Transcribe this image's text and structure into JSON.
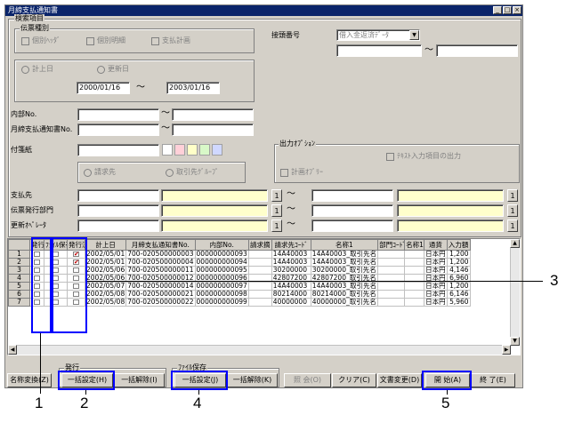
{
  "window": {
    "title": "月締支払通知書",
    "controls": [
      "_",
      "□",
      "×"
    ]
  },
  "search": {
    "group_label": "検索項目",
    "slip_type": {
      "label": "伝票種別",
      "options": [
        "個別ﾍｯﾀﾞ",
        "個別明細",
        "支払計画"
      ]
    },
    "output_order": {
      "label": "接頭番号",
      "select_value": "借入金返済ﾃﾞｰﾀ",
      "tilde": "～"
    },
    "date_type": {
      "options": [
        "計上日",
        "更新日"
      ]
    },
    "date_from": "2000/01/16",
    "date_to": "2003/01/16",
    "date_tilde": "～",
    "internal_no": {
      "label": "内部No.",
      "tilde": "～"
    },
    "notice_no": {
      "label": "月締支払通知書No.",
      "tilde": "～"
    },
    "attachment": {
      "label": "付箋紙"
    },
    "payee_type": {
      "options": [
        "請求先",
        "取引先ｸﾞﾙｰﾌﾟ"
      ]
    },
    "output_options": {
      "label": "出力ｵﾌﾟｼｮﾝ",
      "text_input": "ﾃｷｽﾄ入力項目の出力",
      "plan_only": "計画ｵﾌﾞﾘｰ"
    },
    "payee": {
      "label": "支払先",
      "tilde": "～"
    },
    "dept": {
      "label": "伝票発行部門",
      "tilde": "～"
    },
    "updater": {
      "label": "更新ｵﾍﾟﾚｰﾀ",
      "tilde": "～"
    },
    "lookup_btn": "1"
  },
  "swatch_colors": [
    "#ffffff",
    "#ffd0d8",
    "#ffffc8",
    "#d8f8c8",
    "#d0d8ff"
  ],
  "grid": {
    "headers": [
      "",
      "発行",
      "ﾌｧｲﾙ保存",
      "発行済",
      "計上日",
      "月締支払通知書No.",
      "内部No.",
      "請求摘",
      "請求先ｺｰﾄﾞ",
      "名称1",
      "部門ｺｰﾄﾞ",
      "名称1",
      "通貨",
      "入力額"
    ],
    "rows": [
      {
        "n": "1",
        "issued": "✔",
        "date": "2002/05/01",
        "notice": "700-020500000003",
        "internal": "000000000093",
        "code": "14A40003",
        "name": "14A40003_取引先名",
        "cur": "日本円",
        "amt": "1,200"
      },
      {
        "n": "2",
        "issued": "✔",
        "date": "2002/05/01",
        "notice": "700-020500000004",
        "internal": "000000000094",
        "code": "14A40003",
        "name": "14A40003_取引先名",
        "cur": "日本円",
        "amt": "1,200"
      },
      {
        "n": "3",
        "issued": "",
        "date": "2002/05/06",
        "notice": "700-020500000011",
        "internal": "000000000095",
        "code": "30200000",
        "name": "30200000_取引先名",
        "cur": "日本円",
        "amt": "4,146"
      },
      {
        "n": "4",
        "issued": "",
        "date": "2002/05/06",
        "notice": "700-020500000012",
        "internal": "000000000096",
        "code": "42807200",
        "name": "42807200_取引先名",
        "cur": "日本円",
        "amt": "6,960"
      },
      {
        "n": "5",
        "issued": "",
        "date": "2002/05/07",
        "notice": "700-020500000014",
        "internal": "000000000097",
        "code": "14A40003",
        "name": "14A40003_取引先名",
        "cur": "日本円",
        "amt": "1,200"
      },
      {
        "n": "6",
        "issued": "",
        "date": "2002/05/08",
        "notice": "700-020500000021",
        "internal": "000000000098",
        "code": "80214000",
        "name": "80214000_取引先名",
        "cur": "日本円",
        "amt": "6,146"
      },
      {
        "n": "7",
        "issued": "",
        "date": "2002/05/08",
        "notice": "700-020500000022",
        "internal": "000000000099",
        "code": "40000000",
        "name": "40000000_取引先名",
        "cur": "日本円",
        "amt": "5,960"
      }
    ]
  },
  "footer": {
    "issue_group": "発行",
    "file_group": "ﾌｧｲﾙ保存",
    "name_change": "名称変換(Z)",
    "issue_set_all": "一括設定(H)",
    "issue_clear_all": "一括解除(I)",
    "file_set_all": "一括設定(J)",
    "file_clear_all": "一括解除(K)",
    "inquiry": "照 会(O)",
    "clear": "クリア(C)",
    "doc_change": "文書変更(D)",
    "start": "開 始(A)",
    "end": "終 了(E)"
  },
  "callouts": [
    "1",
    "2",
    "3",
    "4",
    "5"
  ]
}
